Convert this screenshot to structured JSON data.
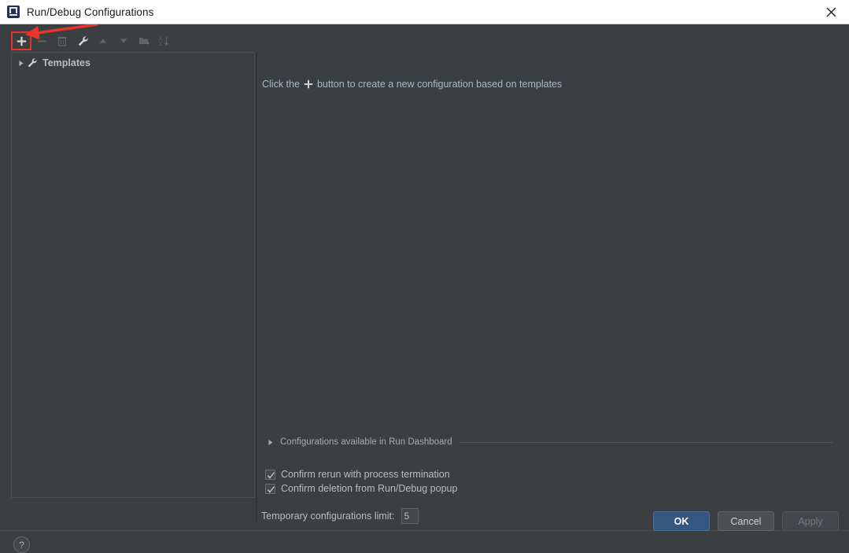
{
  "window": {
    "title": "Run/Debug Configurations",
    "app_icon": "intellij-idea-icon",
    "close_icon": "close-icon"
  },
  "toolbar": {
    "items": [
      {
        "name": "add-configuration-button",
        "icon": "plus-icon",
        "label": "+",
        "enabled": true,
        "highlighted": true
      },
      {
        "name": "remove-configuration-button",
        "icon": "minus-icon",
        "label": "–",
        "enabled": false,
        "highlighted": false
      },
      {
        "name": "copy-configuration-button",
        "icon": "copy-icon",
        "label": "",
        "enabled": false,
        "highlighted": false
      },
      {
        "name": "edit-templates-button",
        "icon": "wrench-icon",
        "label": "",
        "enabled": true,
        "highlighted": false
      },
      {
        "name": "move-up-button",
        "icon": "arrow-up-icon",
        "label": "",
        "enabled": false,
        "highlighted": false
      },
      {
        "name": "move-down-button",
        "icon": "arrow-down-icon",
        "label": "",
        "enabled": false,
        "highlighted": false
      },
      {
        "name": "move-into-folder-button",
        "icon": "folder-move-icon",
        "label": "",
        "enabled": false,
        "highlighted": false
      },
      {
        "name": "sort-configurations-button",
        "icon": "sort-az-icon",
        "label": "",
        "enabled": false,
        "highlighted": false
      }
    ]
  },
  "tree": {
    "items": [
      {
        "label": "Templates",
        "icon": "wrench-icon",
        "expander": "collapsed-triangle-icon",
        "bold": true
      }
    ]
  },
  "main": {
    "hint_prefix": "Click the",
    "hint_plus_icon": "plus-icon",
    "hint_suffix": "button to create a new configuration based on templates"
  },
  "dashboard": {
    "label": "Configurations available in Run Dashboard",
    "expander": "collapsed-triangle-icon",
    "expanded": false
  },
  "options": {
    "confirm_rerun": {
      "label": "Confirm rerun with process termination",
      "checked": true
    },
    "confirm_delete": {
      "label": "Confirm deletion from Run/Debug popup",
      "checked": true
    },
    "temp_limit": {
      "label": "Temporary configurations limit:",
      "value": "5"
    }
  },
  "footer": {
    "help_label": "?",
    "ok_label": "OK",
    "cancel_label": "Cancel",
    "apply_label": "Apply",
    "apply_enabled": false
  },
  "annotation": {
    "type": "red-arrow",
    "color": "#e8342a",
    "points_to": "add-configuration-button"
  },
  "colors": {
    "dialog_background": "#3c3f41",
    "titlebar_background": "#ffffff",
    "accent_ok": "#365880",
    "annotation_red": "#e8342a",
    "text_primary": "#bbbbbb",
    "hint_text": "#a9b7c6"
  }
}
